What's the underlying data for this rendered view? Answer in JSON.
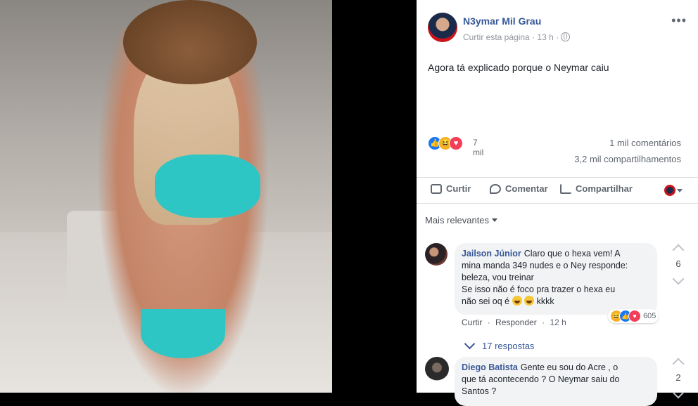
{
  "post": {
    "page_name": "N3ymar Mil Grau",
    "like_page": "Curtir esta página",
    "separator": "·",
    "time": "13 h",
    "text": "Agora tá explicado porque o Neymar caiu",
    "reactions_count": "7 mil",
    "comments_count": "1 mil comentários",
    "shares_count": "3,2 mil compartilhamentos"
  },
  "actions": {
    "like": "Curtir",
    "comment": "Comentar",
    "share": "Compartilhar"
  },
  "filter": {
    "label": "Mais relevantes"
  },
  "comments": [
    {
      "author": "Jailson Júnior",
      "lines": [
        "Claro que o hexa vem! A",
        "mina manda 349 nudes e o Ney responde:",
        "beleza, vou treinar",
        "Se isso não é foco pra trazer o hexa eu",
        "não sei oq é"
      ],
      "trail": "kkkk",
      "like": "Curtir",
      "reply": "Responder",
      "time": "12 h",
      "reaction_count": "605",
      "score": "6",
      "replies": "17 respostas"
    },
    {
      "author": "Diego Batista",
      "lines": [
        "Gente eu sou do Acre , o",
        "que tá acontecendo ? O Neymar saiu do",
        "Santos ?"
      ],
      "score": "2"
    }
  ],
  "colors": {
    "link_blue": "#385898",
    "like_blue": "#1877f2",
    "haha_yellow": "#f7b125",
    "love_red": "#f33e58"
  }
}
